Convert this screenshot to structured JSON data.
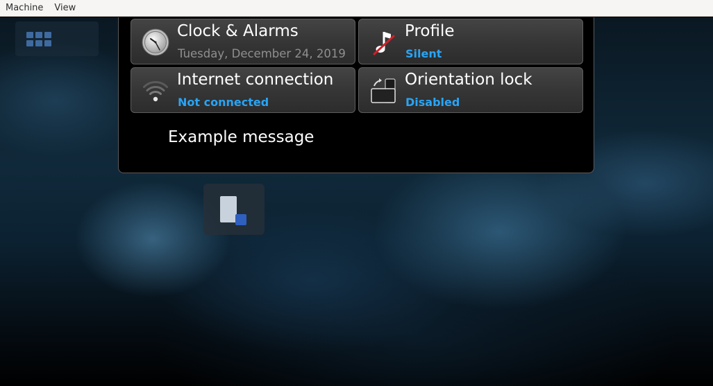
{
  "menubar": {
    "items": [
      {
        "label": "Machine"
      },
      {
        "label": "View"
      }
    ]
  },
  "panel": {
    "tiles": {
      "clock": {
        "title": "Clock & Alarms",
        "subtitle": "Tuesday, December 24, 2019",
        "icon": "clock-icon"
      },
      "profile": {
        "title": "Profile",
        "subtitle": "Silent",
        "icon": "silent-profile-icon"
      },
      "internet": {
        "title": "Internet connection",
        "subtitle": "Not connected",
        "icon": "wifi-icon"
      },
      "orientation": {
        "title": "Orientation lock",
        "subtitle": "Disabled",
        "icon": "orientation-icon"
      }
    },
    "message": "Example message"
  },
  "colors": {
    "accent_blue": "#2aa4f4",
    "subtitle_gray": "#8f8f8f",
    "tile_bg": "#3a3a3a",
    "menubar_bg": "#f6f5f4"
  }
}
